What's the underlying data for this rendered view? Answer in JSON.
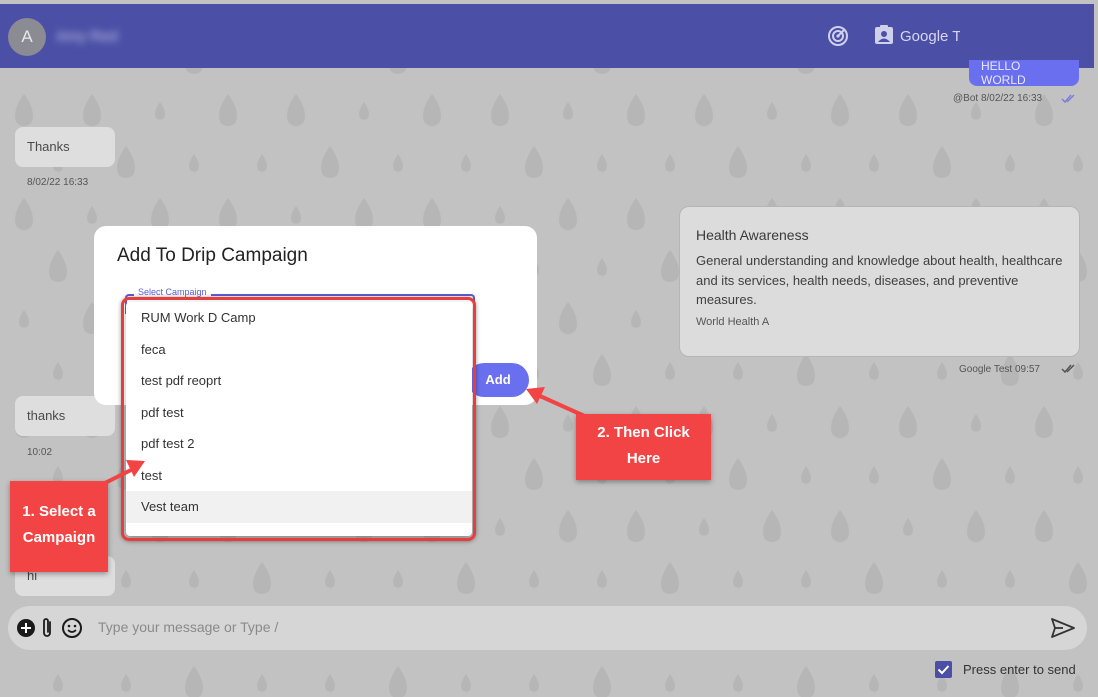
{
  "header": {
    "avatar_letter": "A",
    "contact_name": "Amy Red",
    "account_label": "Google Test",
    "icons": [
      "radar-icon",
      "contact-badge-icon",
      "android-icon",
      "more-vert-icon"
    ]
  },
  "messages": {
    "outgoing_top": {
      "text": "HELLO WORLD",
      "meta": "@Bot 8/02/22 16:33"
    },
    "thanks_1": {
      "text": "Thanks",
      "time": "8/02/22 16:33"
    },
    "card": {
      "title": "Health Awareness",
      "body": "General understanding and knowledge about health, healthcare and its services, health needs, diseases, and preventive measures.",
      "footer": "World Health A",
      "meta": "Google Test 09:57"
    },
    "thanks_2": {
      "text": "thanks",
      "time": "10:02"
    },
    "hi": {
      "text": "hi"
    }
  },
  "composer": {
    "placeholder": "Type your message  or Type /",
    "press_enter_label": "Press enter to send",
    "press_enter_checked": true
  },
  "modal": {
    "title": "Add To Drip Campaign",
    "field_label": "Select Campaign",
    "add_label": "Add",
    "options": [
      "RUM Work D Camp",
      "feca",
      "test pdf reoprt",
      "pdf test",
      "pdf test 2",
      "test",
      "Vest team"
    ],
    "highlighted_option": "Vest team"
  },
  "annotations": {
    "step1_line1": "1. Select a",
    "step1_line2": "Campaign",
    "step2_line1": "2. Then Click",
    "step2_line2": "Here"
  },
  "colors": {
    "header_bg": "#4b4fa6",
    "accent": "#6a6ff0",
    "callout": "#f24444",
    "backdrop": "#c2c2c2"
  }
}
